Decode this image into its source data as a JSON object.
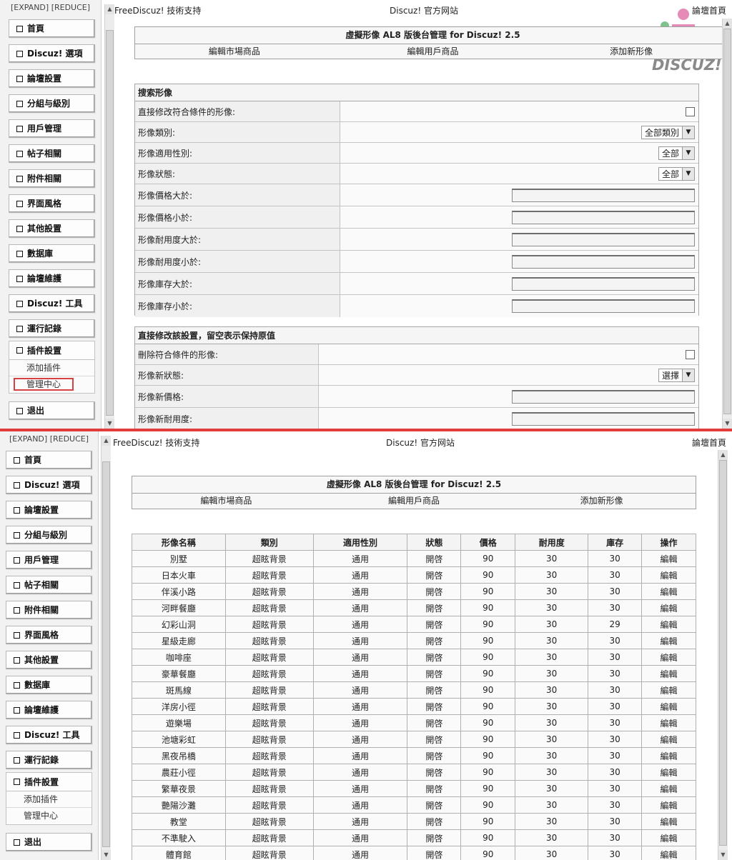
{
  "sidebar": {
    "expand_label": "[EXPAND]  [REDUCE]",
    "menu": [
      "首頁",
      "Discuz! 選項",
      "論壇設置",
      "分組与級別",
      "用戶管理",
      "帖子相關",
      "附件相關",
      "界面風格",
      "其他設置",
      "數据庫",
      "論壇維護",
      "Discuz! 工具",
      "運行記錄"
    ],
    "plugin_label": "插件設置",
    "plugin_sub": [
      "添加插件",
      "管理中心"
    ],
    "logout_label": "退出"
  },
  "topbar": {
    "left": "FreeDiscuz! 技術支持",
    "mid": "Discuz! 官方网站",
    "right": "論壇首頁"
  },
  "header": {
    "title": "虛擬形像 AL8 版後台管理 for Discuz! 2.5",
    "nav": [
      "編輯市場商品",
      "編輯用戶商品",
      "添加新形像"
    ]
  },
  "logo_text": "DISCUZ!",
  "search": {
    "heading": "搜索形像",
    "rows": [
      {
        "label": "直接修改符合條件的形像:",
        "type": "checkbox"
      },
      {
        "label": "形像類別:",
        "type": "select",
        "value": "全部類別"
      },
      {
        "label": "形像適用性別:",
        "type": "select",
        "value": "全部"
      },
      {
        "label": "形像狀態:",
        "type": "select",
        "value": "全部"
      },
      {
        "label": "形像價格大於:",
        "type": "input"
      },
      {
        "label": "形像價格小於:",
        "type": "input"
      },
      {
        "label": "形像耐用度大於:",
        "type": "input"
      },
      {
        "label": "形像耐用度小於:",
        "type": "input"
      },
      {
        "label": "形像庫存大於:",
        "type": "input"
      },
      {
        "label": "形像庫存小於:",
        "type": "input"
      }
    ]
  },
  "modify": {
    "heading": "直接修改該設置，留空表示保持原值",
    "rows": [
      {
        "label": "刪除符合條件的形像:",
        "type": "checkbox"
      },
      {
        "label": "形像新狀態:",
        "type": "select",
        "value": "選擇"
      },
      {
        "label": "形像新價格:",
        "type": "input"
      },
      {
        "label": "形像新耐用度:",
        "type": "input"
      }
    ]
  },
  "table": {
    "columns": [
      "形像名稱",
      "類別",
      "適用性別",
      "狀態",
      "價格",
      "耐用度",
      "庫存",
      "操作"
    ],
    "rows": [
      [
        "別墅",
        "超眩背景",
        "通用",
        "開啓",
        "90",
        "30",
        "30",
        "編輯"
      ],
      [
        "日本火車",
        "超眩背景",
        "通用",
        "開啓",
        "90",
        "30",
        "30",
        "編輯"
      ],
      [
        "伴溪小路",
        "超眩背景",
        "通用",
        "開啓",
        "90",
        "30",
        "30",
        "編輯"
      ],
      [
        "河畔餐廳",
        "超眩背景",
        "通用",
        "開啓",
        "90",
        "30",
        "30",
        "編輯"
      ],
      [
        "幻彩山洞",
        "超眩背景",
        "通用",
        "開啓",
        "90",
        "30",
        "29",
        "編輯"
      ],
      [
        "星級走廊",
        "超眩背景",
        "通用",
        "開啓",
        "90",
        "30",
        "30",
        "編輯"
      ],
      [
        "咖啡座",
        "超眩背景",
        "通用",
        "開啓",
        "90",
        "30",
        "30",
        "編輯"
      ],
      [
        "豪華餐廳",
        "超眩背景",
        "通用",
        "開啓",
        "90",
        "30",
        "30",
        "編輯"
      ],
      [
        "斑馬線",
        "超眩背景",
        "通用",
        "開啓",
        "90",
        "30",
        "30",
        "編輯"
      ],
      [
        "洋房小徑",
        "超眩背景",
        "通用",
        "開啓",
        "90",
        "30",
        "30",
        "編輯"
      ],
      [
        "遊樂場",
        "超眩背景",
        "通用",
        "開啓",
        "90",
        "30",
        "30",
        "編輯"
      ],
      [
        "池塘彩虹",
        "超眩背景",
        "通用",
        "開啓",
        "90",
        "30",
        "30",
        "編輯"
      ],
      [
        "黑夜吊橋",
        "超眩背景",
        "通用",
        "開啓",
        "90",
        "30",
        "30",
        "編輯"
      ],
      [
        "農莊小徑",
        "超眩背景",
        "通用",
        "開啓",
        "90",
        "30",
        "30",
        "編輯"
      ],
      [
        "繁華夜景",
        "超眩背景",
        "通用",
        "開啓",
        "90",
        "30",
        "30",
        "編輯"
      ],
      [
        "艷陽沙灘",
        "超眩背景",
        "通用",
        "開啓",
        "90",
        "30",
        "30",
        "編輯"
      ],
      [
        "教堂",
        "超眩背景",
        "通用",
        "開啓",
        "90",
        "30",
        "30",
        "編輯"
      ],
      [
        "不準駛入",
        "超眩背景",
        "通用",
        "開啓",
        "90",
        "30",
        "30",
        "編輯"
      ],
      [
        "體育館",
        "超眩背景",
        "通用",
        "開啓",
        "90",
        "30",
        "30",
        "編輯"
      ]
    ]
  },
  "colors": {
    "divider": "#e03c3c",
    "highlight_box": "#d64242"
  }
}
